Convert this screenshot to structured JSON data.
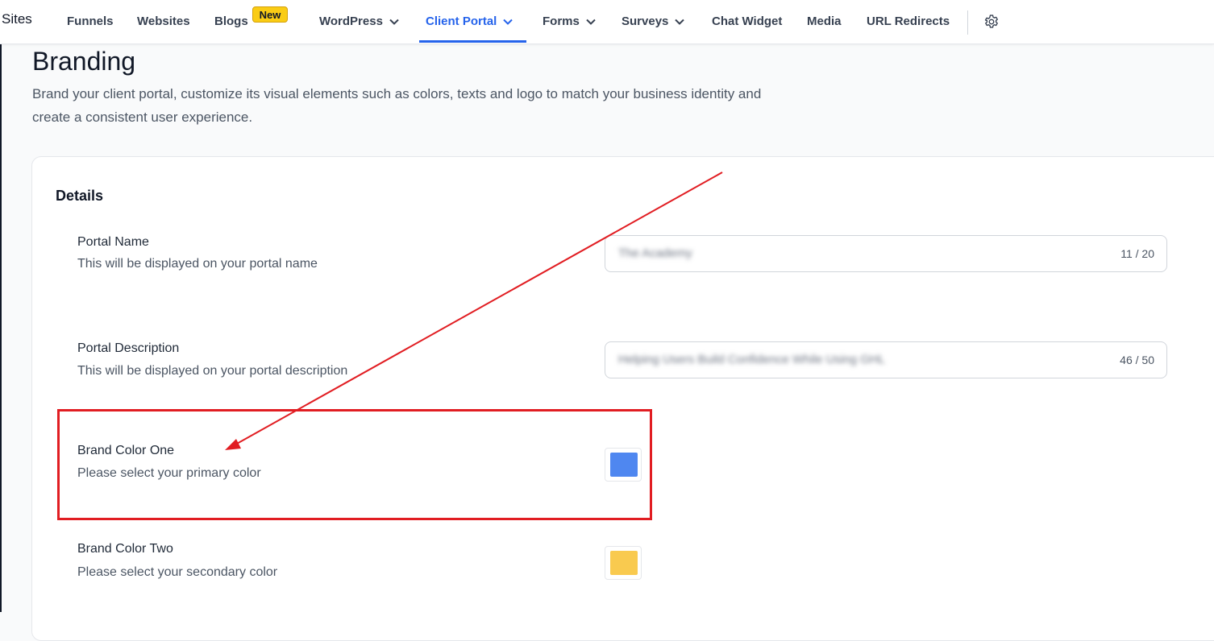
{
  "nav": {
    "brand": "Sites",
    "items": [
      {
        "label": "Funnels"
      },
      {
        "label": "Websites"
      },
      {
        "label": "Blogs",
        "badge": "New"
      },
      {
        "label": "WordPress",
        "dropdown": true
      },
      {
        "label": "Client Portal",
        "dropdown": true,
        "active": true
      },
      {
        "label": "Forms",
        "dropdown": true
      },
      {
        "label": "Surveys",
        "dropdown": true
      },
      {
        "label": "Chat Widget"
      },
      {
        "label": "Media"
      },
      {
        "label": "URL Redirects"
      }
    ],
    "settings_icon": "gear-icon"
  },
  "header": {
    "title": "Branding",
    "description": "Brand your client portal, customize its visual elements such as colors, texts and logo to match your business identity and create a consistent user experience."
  },
  "details": {
    "title": "Details",
    "portal_name": {
      "label": "Portal Name",
      "help": "This will be displayed on your portal name",
      "value": "The Academy",
      "counter": "11 / 20"
    },
    "portal_description": {
      "label": "Portal Description",
      "help": "This will be displayed on your portal description",
      "value": "Helping Users Build Confidence While Using GHL",
      "counter": "46 / 50"
    },
    "brand_color_one": {
      "label": "Brand Color One",
      "help": "Please select your primary color",
      "color": "#4f87f0"
    },
    "brand_color_two": {
      "label": "Brand Color Two",
      "help": "Please select your secondary color",
      "color": "#f9ca4f"
    }
  },
  "colors": {
    "accent": "#2563eb",
    "badge": "#facc15",
    "annotation": "#e11d22"
  }
}
